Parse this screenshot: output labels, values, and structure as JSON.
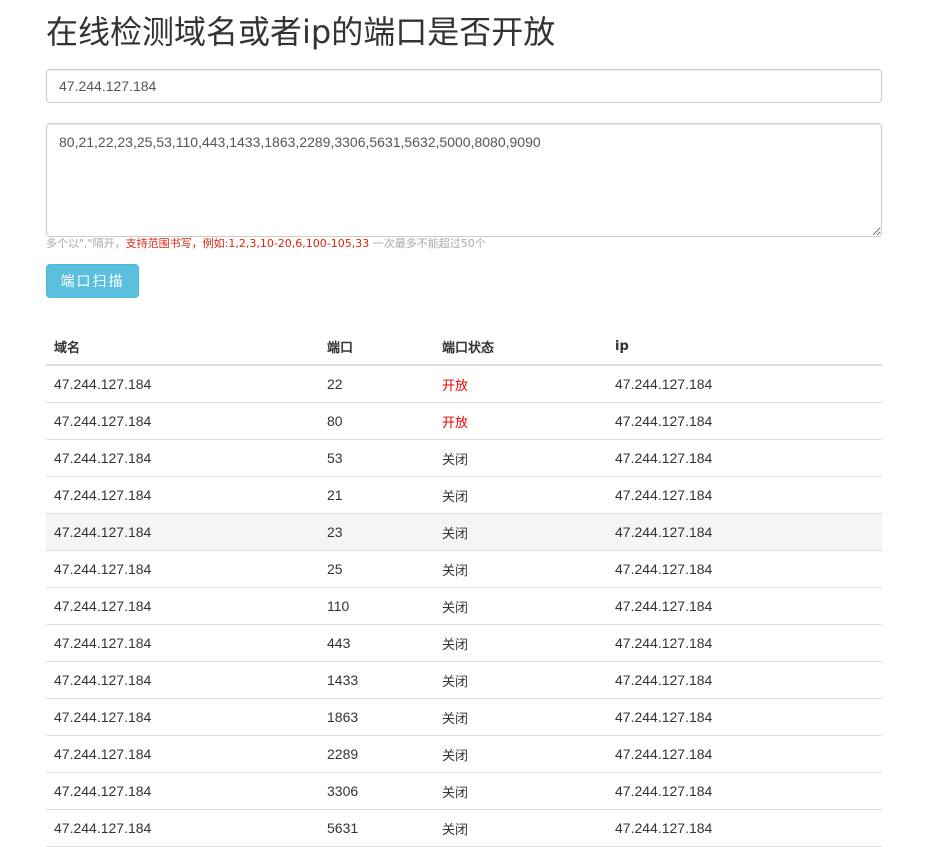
{
  "page": {
    "title": "在线检测域名或者ip的端口是否开放"
  },
  "form": {
    "host_value": "47.244.127.184",
    "ports_value": "80,21,22,23,25,53,110,443,1433,1863,2289,3306,5631,5632,5000,8080,9090",
    "help_prefix": "多个以\",\"隔开，",
    "help_highlight": "支持范围书写，例如:1,2,3,10-20,6,100-105,33",
    "help_suffix": " 一次最多不能超过50个",
    "scan_button_label": "端口扫描"
  },
  "table": {
    "headers": [
      "域名",
      "端口",
      "端口状态",
      "ip"
    ],
    "rows": [
      {
        "domain": "47.244.127.184",
        "port": "22",
        "status": "开放",
        "ip": "47.244.127.184"
      },
      {
        "domain": "47.244.127.184",
        "port": "80",
        "status": "开放",
        "ip": "47.244.127.184"
      },
      {
        "domain": "47.244.127.184",
        "port": "53",
        "status": "关闭",
        "ip": "47.244.127.184"
      },
      {
        "domain": "47.244.127.184",
        "port": "21",
        "status": "关闭",
        "ip": "47.244.127.184"
      },
      {
        "domain": "47.244.127.184",
        "port": "23",
        "status": "关闭",
        "ip": "47.244.127.184"
      },
      {
        "domain": "47.244.127.184",
        "port": "25",
        "status": "关闭",
        "ip": "47.244.127.184"
      },
      {
        "domain": "47.244.127.184",
        "port": "110",
        "status": "关闭",
        "ip": "47.244.127.184"
      },
      {
        "domain": "47.244.127.184",
        "port": "443",
        "status": "关闭",
        "ip": "47.244.127.184"
      },
      {
        "domain": "47.244.127.184",
        "port": "1433",
        "status": "关闭",
        "ip": "47.244.127.184"
      },
      {
        "domain": "47.244.127.184",
        "port": "1863",
        "status": "关闭",
        "ip": "47.244.127.184"
      },
      {
        "domain": "47.244.127.184",
        "port": "2289",
        "status": "关闭",
        "ip": "47.244.127.184"
      },
      {
        "domain": "47.244.127.184",
        "port": "3306",
        "status": "关闭",
        "ip": "47.244.127.184"
      },
      {
        "domain": "47.244.127.184",
        "port": "5631",
        "status": "关闭",
        "ip": "47.244.127.184"
      }
    ]
  },
  "colors": {
    "open_status": "#ee0000",
    "button_bg": "#5bc0de",
    "help_highlight": "#d9230f"
  }
}
